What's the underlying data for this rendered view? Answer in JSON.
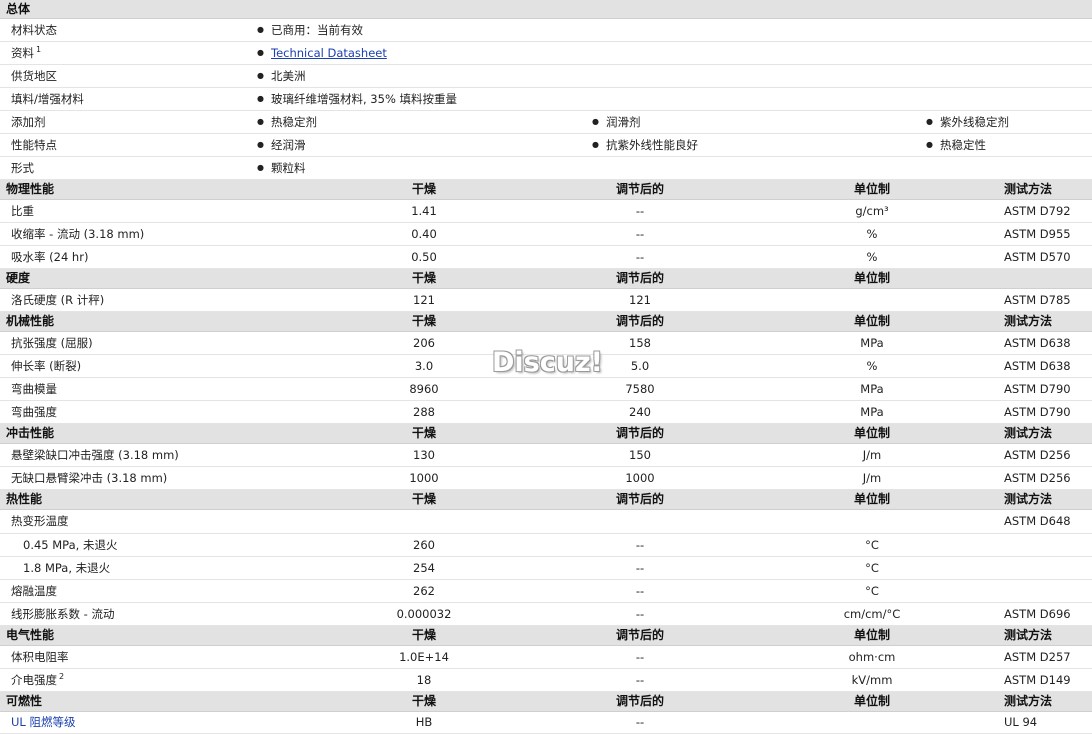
{
  "general": {
    "title": "总体",
    "material_status": {
      "label": "材料状态",
      "value": "已商用：当前有效"
    },
    "documents": {
      "label": "资料",
      "footnote": "1",
      "link": "Technical Datasheet"
    },
    "availability": {
      "label": "供货地区",
      "value": "北美洲"
    },
    "filler": {
      "label": "填料/增强材料",
      "value": "玻璃纤维增强材料, 35% 填料按重量"
    },
    "additives": {
      "label": "添加剂",
      "values": [
        "热稳定剂",
        "润滑剂",
        "紫外线稳定剂"
      ]
    },
    "features": {
      "label": "性能特点",
      "values": [
        "经润滑",
        "抗紫外线性能良好",
        "热稳定性"
      ]
    },
    "forms": {
      "label": "形式",
      "value": "颗粒料"
    }
  },
  "columns": {
    "dry": "干燥",
    "conditioned": "调节后的",
    "unit": "单位制",
    "method": "测试方法"
  },
  "sections": [
    {
      "title": "物理性能",
      "show_method": true,
      "rows": [
        {
          "label": "比重",
          "dry": "1.41",
          "cond": "--",
          "unit": "g/cm³",
          "method": "ASTM D792"
        },
        {
          "label": "收缩率  - 流动  (3.18 mm)",
          "dry": "0.40",
          "cond": "--",
          "unit": "%",
          "method": "ASTM D955"
        },
        {
          "label": "吸水率  (24 hr)",
          "dry": "0.50",
          "cond": "--",
          "unit": "%",
          "method": "ASTM D570"
        }
      ]
    },
    {
      "title": "硬度",
      "show_method": false,
      "rows": [
        {
          "label": "洛氏硬度  (R 计秤)",
          "dry": "121",
          "cond": "121",
          "unit": "",
          "method": "ASTM D785"
        }
      ]
    },
    {
      "title": "机械性能",
      "show_method": true,
      "rows": [
        {
          "label": "抗张强度  (屈服)",
          "dry": "206",
          "cond": "158",
          "unit": "MPa",
          "method": "ASTM D638"
        },
        {
          "label": "伸长率  (断裂)",
          "dry": "3.0",
          "cond": "5.0",
          "unit": "%",
          "method": "ASTM D638"
        },
        {
          "label": "弯曲模量",
          "dry": "8960",
          "cond": "7580",
          "unit": "MPa",
          "method": "ASTM D790"
        },
        {
          "label": "弯曲强度",
          "dry": "288",
          "cond": "240",
          "unit": "MPa",
          "method": "ASTM D790"
        }
      ]
    },
    {
      "title": "冲击性能",
      "show_method": true,
      "rows": [
        {
          "label": "悬壁梁缺口冲击强度  (3.18 mm)",
          "dry": "130",
          "cond": "150",
          "unit": "J/m",
          "method": "ASTM D256"
        },
        {
          "label": "无缺口悬臂梁冲击  (3.18 mm)",
          "dry": "1000",
          "cond": "1000",
          "unit": "J/m",
          "method": "ASTM D256"
        }
      ]
    },
    {
      "title": "热性能",
      "show_method": true,
      "rows": [
        {
          "label": "热变形温度",
          "dry": "",
          "cond": "",
          "unit": "",
          "method": "ASTM D648"
        },
        {
          "label": "0.45 MPa, 未退火",
          "sub": true,
          "dry": "260",
          "cond": "--",
          "unit": "°C",
          "method": ""
        },
        {
          "label": "1.8 MPa, 未退火",
          "sub": true,
          "dry": "254",
          "cond": "--",
          "unit": "°C",
          "method": ""
        },
        {
          "label": "熔融温度",
          "dry": "262",
          "cond": "--",
          "unit": "°C",
          "method": ""
        },
        {
          "label": "线形膨胀系数  - 流动",
          "dry": "0.000032",
          "cond": "--",
          "unit": "cm/cm/°C",
          "method": "ASTM D696"
        }
      ]
    },
    {
      "title": "电气性能",
      "show_method": true,
      "rows": [
        {
          "label": "体积电阻率",
          "dry": "1.0E+14",
          "cond": "--",
          "unit": "ohm·cm",
          "method": "ASTM D257"
        },
        {
          "label": "介电强度",
          "footnote": "2",
          "dry": "18",
          "cond": "--",
          "unit": "kV/mm",
          "method": "ASTM D149"
        }
      ]
    },
    {
      "title": "可燃性",
      "show_method": true,
      "rows": [
        {
          "label": "UL 阻燃等级",
          "link": true,
          "dry": "HB",
          "cond": "--",
          "unit": "",
          "method": "UL 94"
        }
      ]
    }
  ],
  "watermark": "Discuz!"
}
